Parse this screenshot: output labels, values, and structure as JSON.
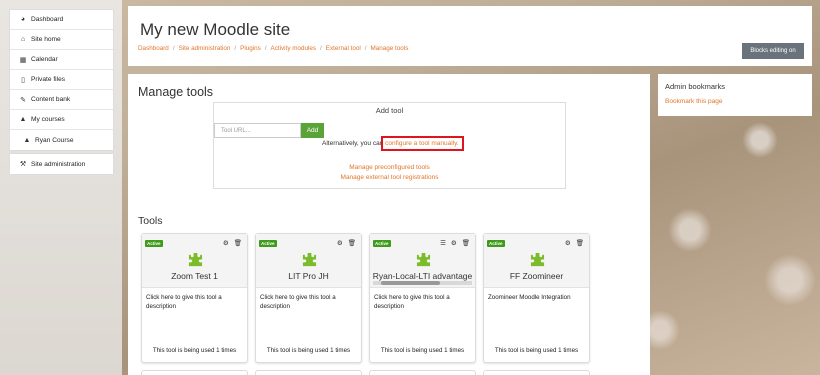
{
  "nav": {
    "primary": [
      {
        "icon": "dashboard-icon",
        "glyph": "◕",
        "label": "Dashboard"
      },
      {
        "icon": "home-icon",
        "glyph": "⌂",
        "label": "Site home"
      },
      {
        "icon": "calendar-icon",
        "glyph": "▦",
        "label": "Calendar"
      },
      {
        "icon": "file-icon",
        "glyph": "▯",
        "label": "Private files"
      },
      {
        "icon": "brush-icon",
        "glyph": "✎",
        "label": "Content bank"
      },
      {
        "icon": "graduation-cap-icon",
        "glyph": "🎓",
        "label": "My courses"
      },
      {
        "icon": "graduation-cap-icon",
        "glyph": "🎓",
        "label": "Ryan Course"
      }
    ],
    "admin": {
      "icon": "wrench-icon",
      "glyph": "🔧",
      "label": "Site administration"
    }
  },
  "header": {
    "title": "My new Moodle site",
    "breadcrumb": [
      "Dashboard",
      "Site administration",
      "Plugins",
      "Activity modules",
      "External tool",
      "Manage tools"
    ],
    "blocks_button": "Blocks editing on"
  },
  "main": {
    "heading": "Manage tools",
    "add_tool": {
      "title": "Add tool",
      "url_placeholder": "Tool URL...",
      "add_button": "Add",
      "alt_text": "Alternatively, you can ",
      "alt_link": "configure a tool manually.",
      "link_preconfigured": "Manage preconfigured tools",
      "link_registrations": "Manage external tool registrations"
    },
    "tools_heading": "Tools",
    "tools": [
      {
        "badge": "Active",
        "name": "Zoom Test 1",
        "description": "Click here to give this tool a description",
        "usage": "This tool is being used 1 times",
        "icons": [
          "gear-icon",
          "trash-icon"
        ],
        "scroll": false
      },
      {
        "badge": "Active",
        "name": "LIT Pro JH",
        "description": "Click here to give this tool a description",
        "usage": "This tool is being used 1 times",
        "icons": [
          "gear-icon",
          "trash-icon"
        ],
        "scroll": false
      },
      {
        "badge": "Active",
        "name": "Ryan-Local-LTI advantage",
        "description": "Click here to give this tool a description",
        "usage": "This tool is being used 1 times",
        "icons": [
          "list-icon",
          "gear-icon",
          "trash-icon"
        ],
        "scroll": true
      },
      {
        "badge": "Active",
        "name": "FF Zoomineer",
        "description": "Zoomineer Moodle Integration",
        "usage": "This tool is being used 1 times",
        "icons": [
          "gear-icon",
          "trash-icon"
        ],
        "scroll": false
      }
    ]
  },
  "admin_bookmarks": {
    "title": "Admin bookmarks",
    "link": "Bookmark this page"
  },
  "colors": {
    "accent": "#e1762b",
    "active_badge": "#3f9b1c",
    "add_button": "#5aa338",
    "highlight": "#e0141b"
  }
}
